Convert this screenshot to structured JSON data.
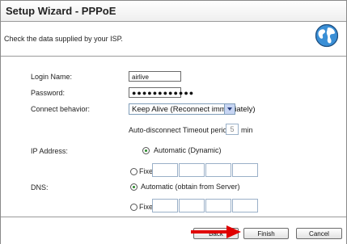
{
  "header": {
    "title": "Setup Wizard - PPPoE"
  },
  "instruction": "Check the data supplied by your ISP.",
  "form": {
    "login_name_label": "Login Name:",
    "login_name_value": "airlive",
    "password_label": "Password:",
    "password_value": "●●●●●●●●●●●●",
    "connect_behavior_label": "Connect behavior:",
    "connect_behavior_value": "Keep Alive (Reconnect immediately)",
    "auto_disconnect_label": "Auto-disconnect Timeout period:",
    "auto_disconnect_value": "5",
    "auto_disconnect_unit": "min",
    "ip_address_label": "IP Address:",
    "ip_automatic_label": "Automatic (Dynamic)",
    "ip_fixed_label": "Fixed:",
    "dns_label": "DNS:",
    "dns_automatic_label": "Automatic (obtain from Server)",
    "dns_fixed_label": "Fixed:"
  },
  "buttons": {
    "back": "Back",
    "finish": "Finish",
    "cancel": "Cancel"
  },
  "colors": {
    "accent_arrow": "#e00000",
    "select_border": "#7f9db9"
  },
  "icons": {
    "globe": "globe-icon",
    "arrow": "red-arrow-icon"
  }
}
